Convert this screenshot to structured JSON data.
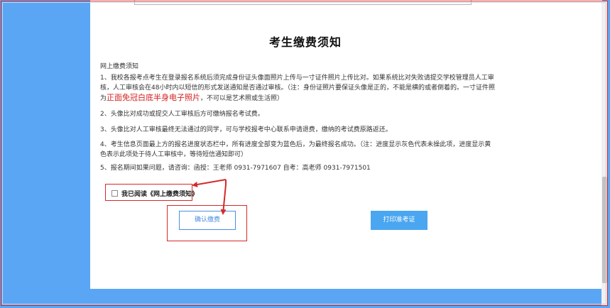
{
  "notice": {
    "title": "考生缴费须知",
    "section_heading": "网上缴费须知",
    "items": [
      {
        "text": "1、我校各报考点考生在登录报名系统后须完成身份证头像面照片上传与一寸证件照片上传比对。如果系统比对失败请提交学校管理员人工审核，人工审核会在48小时内以短信的形式发送通知是否通过审核。（注：身份证照片要保证头像是正的，不能是横的或者倒着的。一寸证件照为",
        "highlight": "正面免冠白底半身电子照片",
        "suffix": "，不可以是艺术照或生活照）"
      },
      {
        "text": "2、头像比对成功或提交人工审核后方可缴纳报名考试费。"
      },
      {
        "text": "3、头像比对人工审核最终无法通过的同学，可与学校报考中心联系申请退费，缴纳的考试费原路返还。"
      },
      {
        "text": "4、考生信息页面最上方的报名进度状态栏中，所有进度全部变为蓝色后，为最终报名成功。（注：进度显示灰色代表未操此项，进度显示黄色表示此项处于待人工审核中，等待短信通知即可）"
      },
      {
        "text": "5、报名期间如果问题，请咨询：函授：王老师 0931-7971607      自考：高老师 0931-7971501"
      }
    ]
  },
  "agreement": {
    "label": "我已阅读《网上缴费须知》",
    "checked": false
  },
  "buttons": {
    "confirm": "确认缴费",
    "print": "打印准考证"
  },
  "colors": {
    "page_background": "#5aa6f5",
    "highlight_red": "#d42020",
    "annotation_red": "#d42a2a",
    "button_blue": "#4aa6f0"
  }
}
